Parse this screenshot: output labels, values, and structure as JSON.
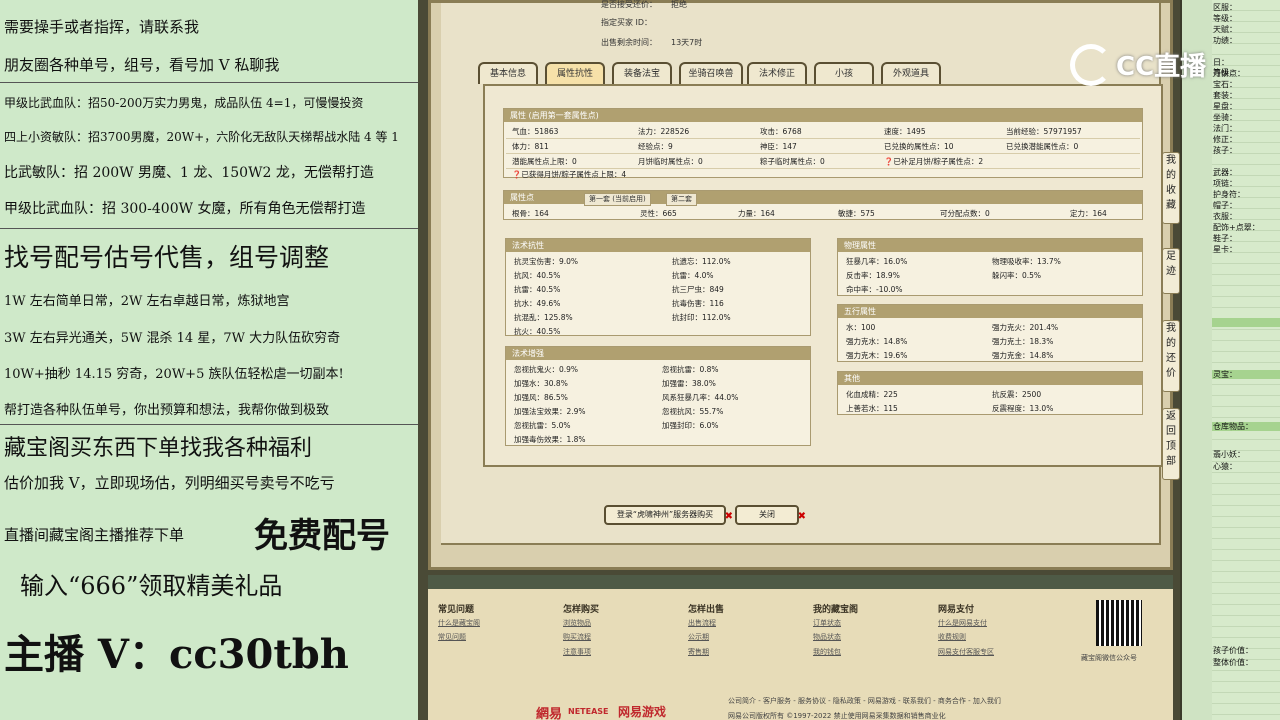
{
  "left_panel": {
    "lines": [
      "需要操手或者指挥，请联系我",
      "朋友圈各种单号，组号，看号加 V 私聊我",
      "甲级比武血队：招50-200万实力男鬼，成品队伍 4=1，可慢慢投资",
      "四上小资敏队：招3700男魔，20W+，六阶化无敌队天梯帮战水陆 4 等 1",
      "比武敏队：招 200W 男魔、1 龙、150W2 龙，无偿帮打造",
      "甲级比武血队：招 300-400W 女魔，所有角色无偿帮打造",
      "找号配号估号代售，组号调整",
      "1W 左右简单日常，2W 左右卓越日常，炼狱地宫",
      "3W 左右异光通关，5W 混杀 14 星，7W 大力队伍砍穷奇",
      "10W+抽秒 14.15 穷奇，20W+5 族队伍轻松虐一切副本!",
      "帮打造各种队伍单号，你出预算和想法，我帮你做到极致",
      "藏宝阁买东西下单找我各种福利",
      "估价加我 V，立即现场估，列明细买号卖号不吃亏",
      "直播间藏宝阁主播推荐下单",
      "免费配号",
      "输入“666”领取精美礼品",
      "主播 V：cc30tbh"
    ]
  },
  "listing": {
    "top_labels": [
      "是否接受还价：",
      "拒绝",
      "指定买家 ID：",
      "出售剩余时间：",
      "13天7时"
    ],
    "tabs": [
      "基本信息",
      "属性抗性",
      "装备法宝",
      "坐骑召唤兽",
      "法术修正",
      "小孩",
      "外观道具"
    ],
    "attr": {
      "title": "属性 (启用第一套属性点)",
      "rows": [
        [
          "气血：51863",
          "法力：228526",
          "攻击：6768",
          "速度：1495",
          "当前经验：57971957"
        ],
        [
          "体力：811",
          "经验点：9",
          "神臣：147",
          "已兑换的属性点：10",
          "已兑换潜能属性点：0"
        ],
        [
          "潜能属性点上限：0",
          "月饼临时属性点：0",
          "粽子临时属性点：0",
          "已补足月饼/粽子属性点：2",
          ""
        ],
        [
          "已获得月饼/粽子属性点上限：4",
          "",
          "",
          "",
          ""
        ]
      ]
    },
    "points": {
      "title": "属性点",
      "subtabs": [
        "第一套 (当前启用)",
        "第二套"
      ],
      "row": [
        "根骨：164",
        "灵性：665",
        "力量：164",
        "敏捷：575",
        "可分配点数：0",
        "定力：164"
      ]
    },
    "resist": {
      "title": "法术抗性",
      "rows": [
        [
          "抗灵宝伤害：9.0%",
          "抗遗忘：112.0%"
        ],
        [
          "抗风：40.5%",
          "抗雷：4.0%"
        ],
        [
          "抗雷：40.5%",
          "抗三尸虫：849"
        ],
        [
          "抗水：49.6%",
          "抗毒伤害：116"
        ],
        [
          "抗混乱：125.8%",
          "抗封印：112.0%"
        ],
        [
          "抗火：40.5%",
          ""
        ]
      ]
    },
    "boost": {
      "title": "法术增强",
      "rows": [
        [
          "忽视抗鬼火：0.9%",
          "忽视抗雷：0.8%"
        ],
        [
          "加强水：30.8%",
          "加强雷：38.0%"
        ],
        [
          "加强风：86.5%",
          "风系狂暴几率：44.0%"
        ],
        [
          "加强法宝效果：2.9%",
          "忽视抗风：55.7%"
        ],
        [
          "忽视抗雷：5.0%",
          "加强封印：6.0%"
        ],
        [
          "加强毒伤效果：1.8%",
          ""
        ]
      ]
    },
    "physical": {
      "title": "物理属性",
      "rows": [
        [
          "狂暴几率：16.0%",
          "物理吸收率：13.7%"
        ],
        [
          "反击率：18.9%",
          "躲闪率：0.5%"
        ],
        [
          "命中率：-10.0%",
          ""
        ]
      ]
    },
    "elements": {
      "title": "五行属性",
      "rows": [
        [
          "水：100",
          "强力克火：201.4%"
        ],
        [
          "强力克水：14.8%",
          "强力克土：18.3%"
        ],
        [
          "强力克木：19.6%",
          "强力克金：14.8%"
        ]
      ]
    },
    "other": {
      "title": "其他",
      "rows": [
        [
          "化血成精：225",
          "抗反震：2500"
        ],
        [
          "上善若水：115",
          "反震程度：13.0%"
        ]
      ]
    },
    "buttons": {
      "login": "登录“虎啸神州”服务器购买",
      "close": "关闭"
    }
  },
  "side_tabs": [
    "我的收藏",
    "足迹",
    "我的还价",
    "返回顶部"
  ],
  "footer": {
    "cols": [
      {
        "title": "常见问题",
        "links": [
          "什么是藏宝阁",
          "常见问题"
        ]
      },
      {
        "title": "怎样购买",
        "links": [
          "浏览物品",
          "购买流程",
          "注意事项"
        ]
      },
      {
        "title": "怎样出售",
        "links": [
          "出售流程",
          "公示期",
          "寄售期"
        ]
      },
      {
        "title": "我的藏宝阁",
        "links": [
          "订单状态",
          "物品状态",
          "我的钱包"
        ]
      },
      {
        "title": "网易支付",
        "links": [
          "什么是网易支付",
          "收费规则",
          "网易支付客服专区"
        ]
      }
    ],
    "qr_caption": "藏宝阁微信公众号",
    "brand1": "網易",
    "brand1_en": "NETEASE",
    "brand2": "网易游戏",
    "links_line": "公司简介 - 客户服务 - 服务协议 - 隐私政策 - 网易游戏 - 联系我们 - 商务合作 - 加入我们",
    "copyright": "网易公司版权所有 ©1997-2022 禁止使用网易采集数据和销售商业化"
  },
  "right_panel": {
    "labels": [
      "区服：",
      "等级：",
      "天赋：",
      "功绩：",
      "",
      "日：",
      "月饼点：",
      "宝石：",
      "套装：",
      "星盘：",
      "坐骑：",
      "法门：",
      "修正：",
      "孩子：",
      "",
      "武器：",
      "项链：",
      "护身符：",
      "帽子：",
      "衣服：",
      "配饰+点翠：",
      "鞋子：",
      "星卡："
    ],
    "labels2": [
      "灵宝：",
      "仓库物品：",
      "翡小妖：",
      "心猿："
    ],
    "labels3": [
      "孩子价值：",
      "整体价值："
    ],
    "peek": "等级："
  },
  "watermark": {
    "text": "CC直播"
  },
  "colors": {
    "left_bg": "#cfe9c9",
    "highlight": "#a6d38f",
    "panel_header": "#b0a070"
  }
}
